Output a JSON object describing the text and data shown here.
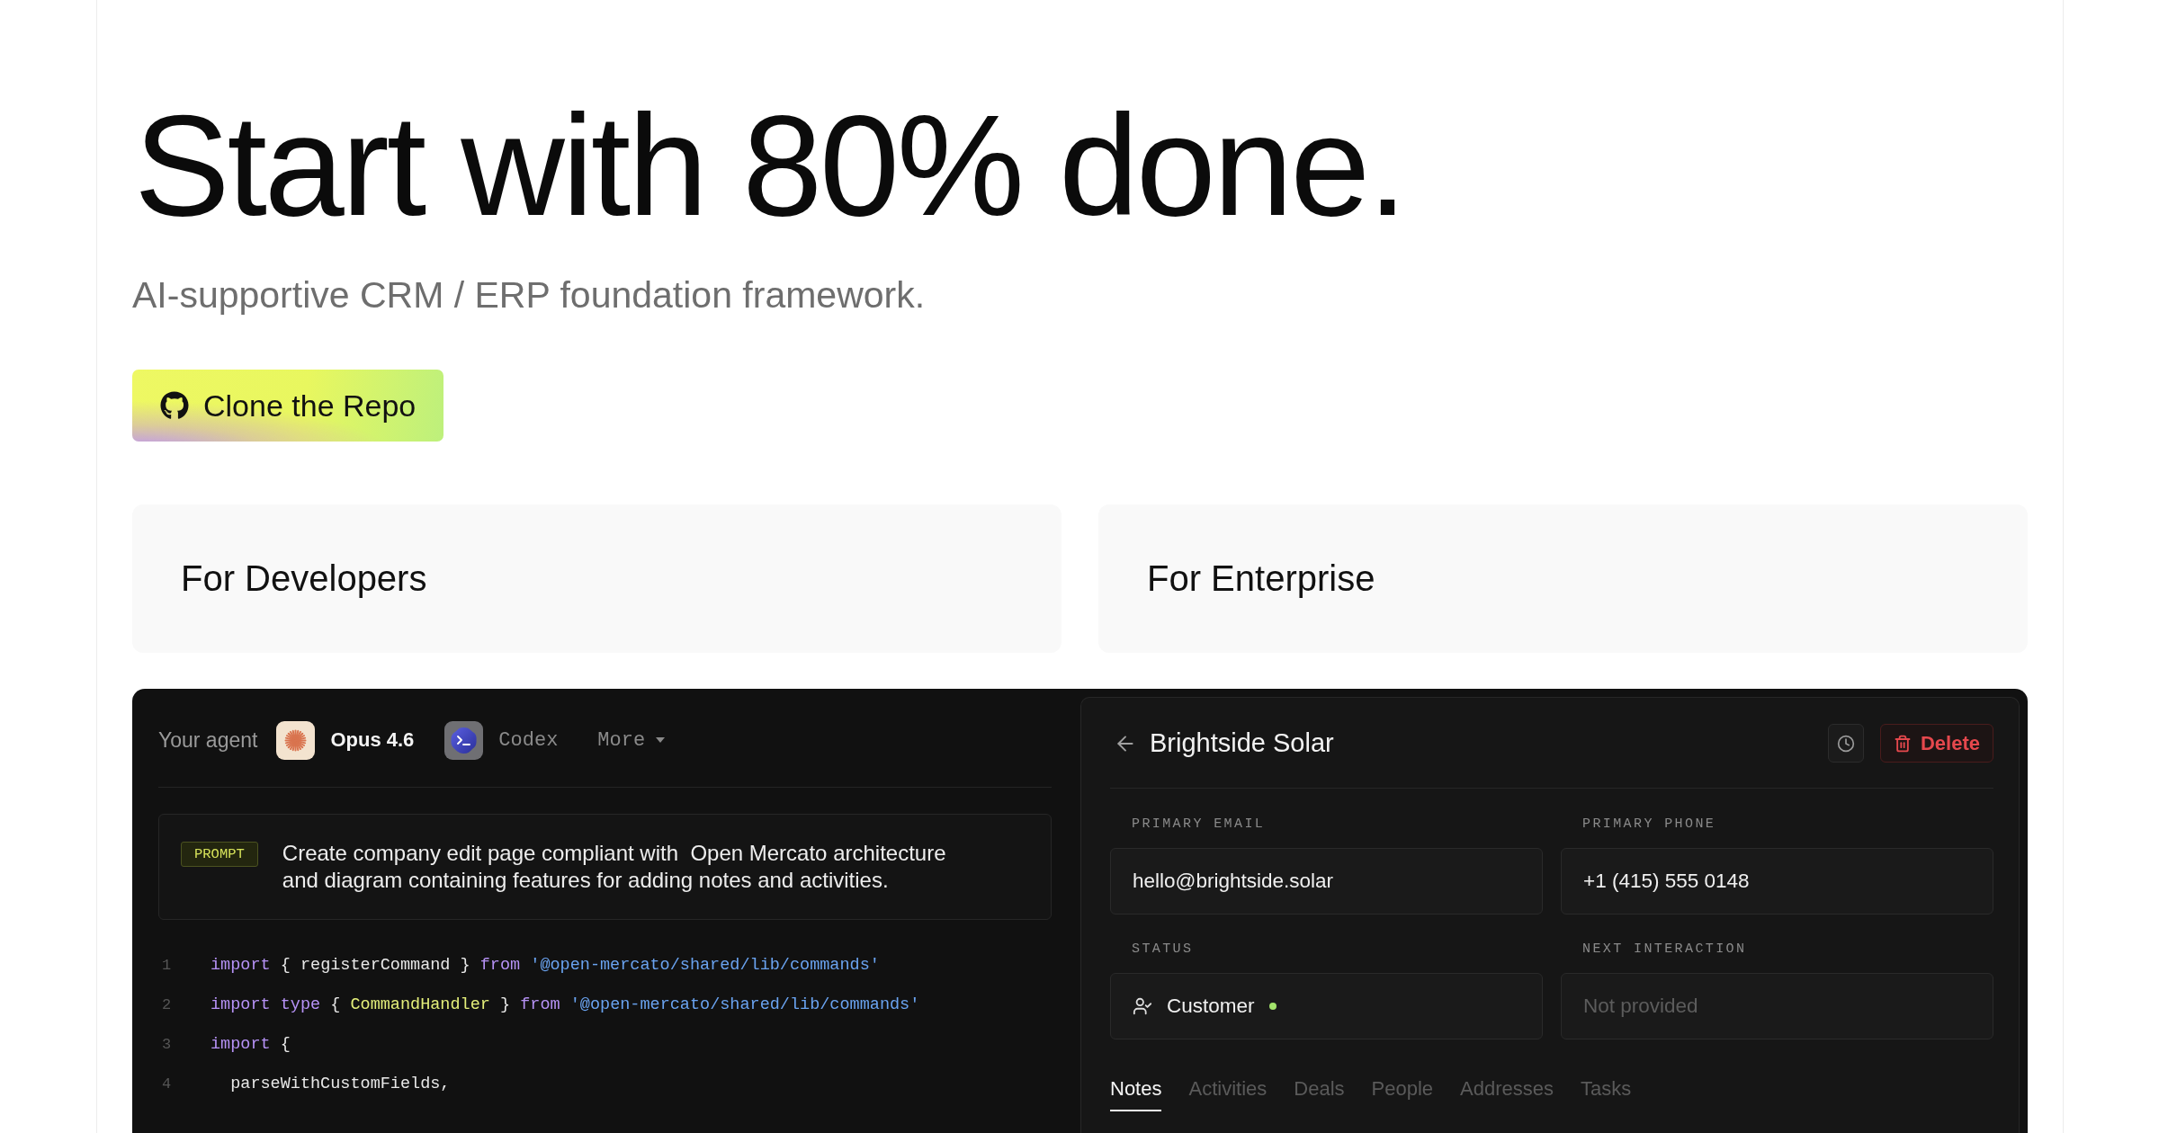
{
  "hero": {
    "title": "Start with 80% done.",
    "subtitle": "AI-supportive CRM / ERP foundation framework.",
    "cta": {
      "label": "Clone the Repo"
    }
  },
  "cards": [
    {
      "title": "For Developers"
    },
    {
      "title": "For Enterprise"
    }
  ],
  "demo": {
    "agent_bar": {
      "label": "Your agent",
      "agents": [
        {
          "kind": "opus",
          "name": "Opus 4.6",
          "selected": true
        },
        {
          "kind": "codex",
          "name": "Codex",
          "selected": false
        }
      ],
      "more": "More"
    },
    "prompt": {
      "badge": "PROMPT",
      "text": "Create company edit page compliant with  Open Mercato architecture and diagram containing features for adding notes and activities."
    },
    "code": [
      {
        "number": "1",
        "tokens": [
          {
            "kind": "keyword",
            "text": "import"
          },
          {
            "kind": "plain",
            "text": " { registerCommand } "
          },
          {
            "kind": "keyword",
            "text": "from"
          },
          {
            "kind": "string",
            "text": " '@open-mercato/shared/lib/commands'"
          }
        ]
      },
      {
        "number": "2",
        "tokens": [
          {
            "kind": "keyword",
            "text": "import"
          },
          {
            "kind": "keyword",
            "text": " type"
          },
          {
            "kind": "plain",
            "text": " { "
          },
          {
            "kind": "type",
            "text": "CommandHandler"
          },
          {
            "kind": "plain",
            "text": " } "
          },
          {
            "kind": "keyword",
            "text": "from"
          },
          {
            "kind": "string",
            "text": " '@open-mercato/shared/lib/commands'"
          }
        ]
      },
      {
        "number": "3",
        "tokens": [
          {
            "kind": "keyword",
            "text": "import"
          },
          {
            "kind": "plain",
            "text": " {"
          }
        ]
      },
      {
        "number": "4",
        "tokens": [
          {
            "kind": "plain",
            "text": "  parseWithCustomFields,"
          }
        ]
      }
    ],
    "record": {
      "title": "Brightside Solar",
      "delete": "Delete",
      "fields": [
        {
          "kind": "text",
          "label": "PRIMARY EMAIL",
          "value": "hello@brightside.solar"
        },
        {
          "kind": "text",
          "label": "PRIMARY PHONE",
          "value": "+1 (415) 555 0148"
        },
        {
          "kind": "status",
          "label": "STATUS",
          "value": "Customer",
          "color": "#a3e36b"
        },
        {
          "kind": "text",
          "label": "NEXT INTERACTION",
          "placeholder": "Not provided"
        }
      ],
      "tabs": [
        {
          "label": "Notes",
          "selected": true
        },
        {
          "label": "Activities",
          "selected": false
        },
        {
          "label": "Deals",
          "selected": false
        },
        {
          "label": "People",
          "selected": false
        },
        {
          "label": "Addresses",
          "selected": false
        },
        {
          "label": "Tasks",
          "selected": false
        }
      ]
    }
  }
}
